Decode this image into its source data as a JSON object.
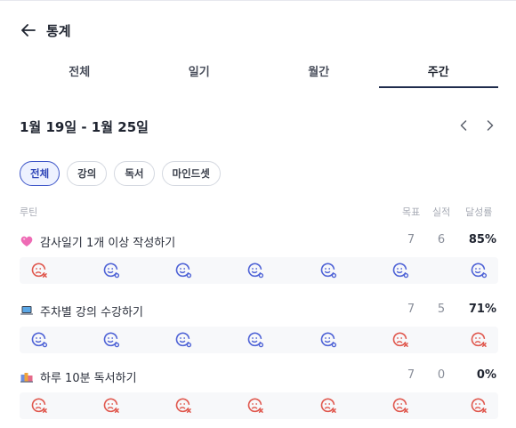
{
  "header": {
    "title": "통계"
  },
  "tabs": [
    {
      "label": "전체",
      "active": false
    },
    {
      "label": "일기",
      "active": false
    },
    {
      "label": "월간",
      "active": false
    },
    {
      "label": "주간",
      "active": true
    }
  ],
  "week": {
    "range": "1월 19일 - 1월 25일"
  },
  "filters": [
    {
      "label": "전체",
      "active": true
    },
    {
      "label": "강의",
      "active": false
    },
    {
      "label": "독서",
      "active": false
    },
    {
      "label": "마인드셋",
      "active": false
    }
  ],
  "columns": {
    "routine": "루틴",
    "goal": "목표",
    "actual": "실적",
    "rate": "달성률"
  },
  "colors": {
    "accent": "#3d55c8",
    "success": "#4f63d6",
    "fail": "#e0584e"
  },
  "routines": [
    {
      "icon": "heart-emoji-icon",
      "name": "감사일기 1개 이상 작성하기",
      "goal": "7",
      "actual": "6",
      "rate": "85%",
      "days": [
        "fail",
        "success",
        "success",
        "success",
        "success",
        "success",
        "success"
      ]
    },
    {
      "icon": "laptop-emoji-icon",
      "name": "주차별 강의 수강하기",
      "goal": "7",
      "actual": "5",
      "rate": "71%",
      "days": [
        "success",
        "success",
        "success",
        "success",
        "success",
        "fail",
        "fail"
      ]
    },
    {
      "icon": "books-emoji-icon",
      "name": "하루 10분 독서하기",
      "goal": "7",
      "actual": "0",
      "rate": "0%",
      "days": [
        "fail",
        "fail",
        "fail",
        "fail",
        "fail",
        "fail",
        "fail"
      ]
    }
  ]
}
